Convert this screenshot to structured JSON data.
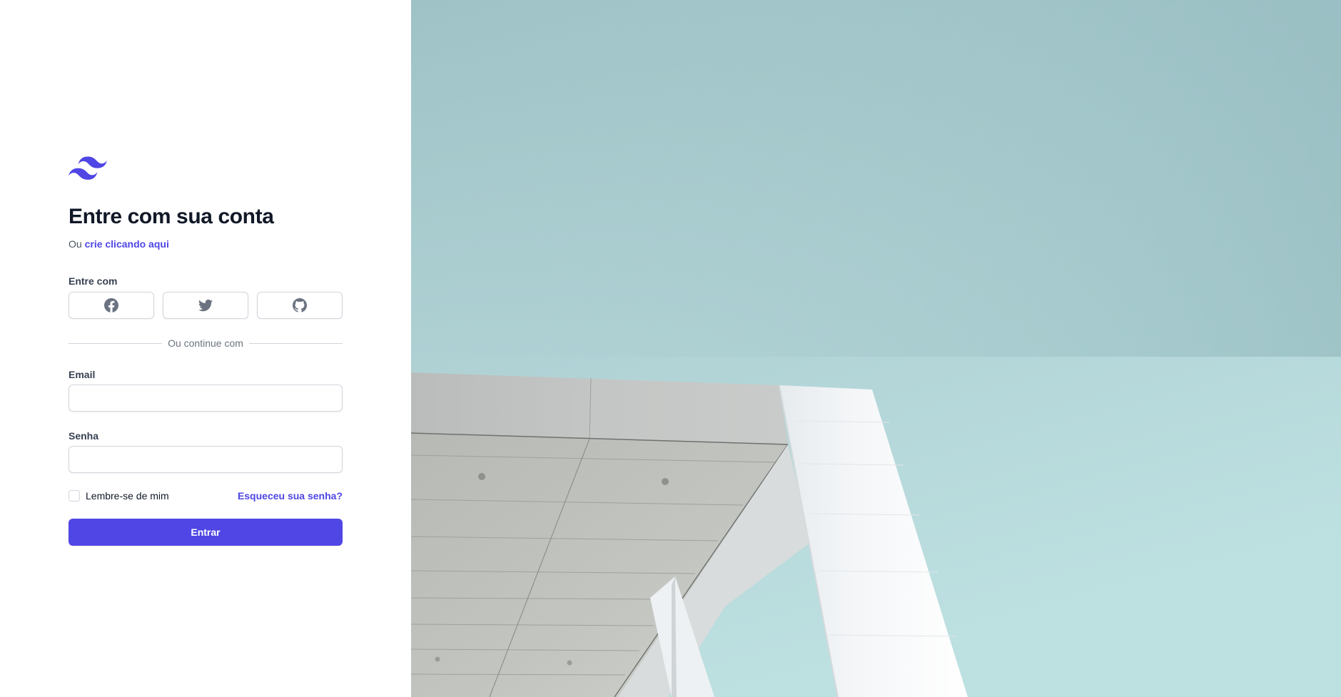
{
  "colors": {
    "accent": "#4f46e5",
    "heading": "#111827",
    "muted": "#6b7280",
    "border": "#d1d5db",
    "sky_top": "#93b9bf",
    "sky_bottom": "#b9dbdc"
  },
  "logo": {
    "icon": "tailwind-waves-logo"
  },
  "login": {
    "title": "Entre com sua conta",
    "subtitle_prefix": "Ou",
    "create_link": "crie clicando aqui",
    "social_label": "Entre com",
    "social": [
      {
        "name": "facebook",
        "icon": "facebook-icon"
      },
      {
        "name": "twitter",
        "icon": "twitter-icon"
      },
      {
        "name": "github",
        "icon": "github-icon"
      }
    ],
    "divider_text": "Ou continue com",
    "email_label": "Email",
    "email_value": "",
    "password_label": "Senha",
    "password_value": "",
    "remember_label": "Lembre-se de mim",
    "remember_checked": false,
    "forgot_link": "Esqueceu sua senha?",
    "submit_label": "Entrar"
  },
  "hero_image": {
    "subject": "white-building-canopy-against-sky"
  }
}
